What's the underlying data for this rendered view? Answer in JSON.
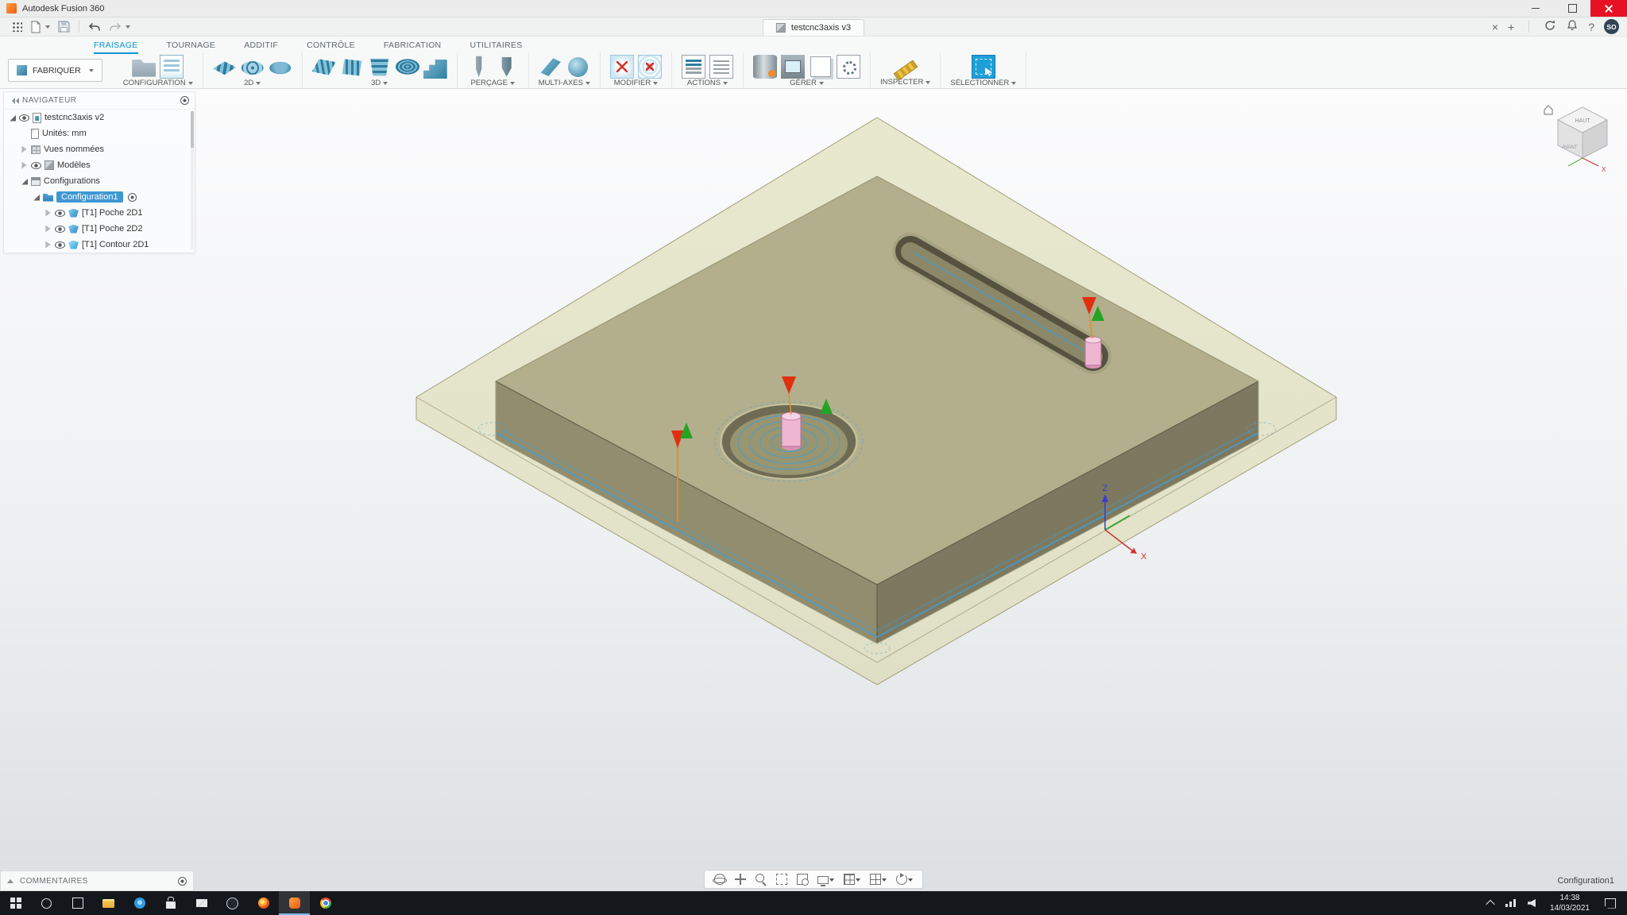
{
  "titlebar": {
    "title": "Autodesk Fusion 360"
  },
  "appbar": {
    "document_tab": "testcnc3axis v3",
    "close_tab_glyph": "×",
    "new_tab_glyph": "+",
    "help_glyph": "?",
    "avatar_initials": "SO"
  },
  "ribbon": {
    "tabs": [
      {
        "label": "FRAISAGE",
        "active": true
      },
      {
        "label": "TOURNAGE"
      },
      {
        "label": "ADDITIF"
      },
      {
        "label": "CONTRÔLE"
      },
      {
        "label": "FABRICATION"
      },
      {
        "label": "UTILITAIRES"
      }
    ],
    "make_button": {
      "label": "FABRIQUER"
    },
    "groups": [
      {
        "label": "CONFIGURATION",
        "icons": [
          "setup-folder",
          "setup-doc"
        ]
      },
      {
        "label": "2D",
        "icons": [
          "face-2d",
          "adaptive-2d",
          "pocket-2d"
        ]
      },
      {
        "label": "3D",
        "icons": [
          "adaptive-3d",
          "parallel-3d",
          "contour-3d",
          "spiral-3d",
          "ramp-3d"
        ]
      },
      {
        "label": "PERÇAGE",
        "icons": [
          "drill",
          "bore"
        ]
      },
      {
        "label": "MULTI-AXES",
        "icons": [
          "swarf",
          "multiaxis"
        ]
      },
      {
        "label": "MODIFIER",
        "icons": [
          "edit-toolpath",
          "delete-toolpath"
        ]
      },
      {
        "label": "ACTIONS",
        "icons": [
          "post-process",
          "simulate"
        ]
      },
      {
        "label": "GÉRER",
        "icons": [
          "tool-library",
          "machine-library",
          "templates",
          "post-library"
        ]
      },
      {
        "label": "INSPECTER",
        "icons": [
          "measure"
        ]
      },
      {
        "label": "SÉLECTIONNER",
        "icons": [
          "select-window"
        ]
      }
    ]
  },
  "navigator": {
    "title": "NAVIGATEUR",
    "items": [
      {
        "label": "testcnc3axis v2",
        "level": 0,
        "icons": [
          "expand-open",
          "eye",
          "doc-cube"
        ]
      },
      {
        "label": "Unités: mm",
        "level": 1,
        "icons": [
          "spacer",
          "doc"
        ]
      },
      {
        "label": "Vues nommées",
        "level": 1,
        "icons": [
          "expand-closed",
          "views"
        ]
      },
      {
        "label": "Modèles",
        "level": 1,
        "icons": [
          "expand-closed",
          "eye",
          "cube"
        ]
      },
      {
        "label": "Configurations",
        "level": 1,
        "icons": [
          "expand-open",
          "configs"
        ]
      },
      {
        "label": "Configuration1",
        "level": 2,
        "icons": [
          "expand-open",
          "folder-config"
        ],
        "selected": true,
        "trailing": [
          "gear-ring"
        ]
      },
      {
        "label": "[T1] Poche 2D1",
        "level": 3,
        "icons": [
          "expand-closed",
          "eye",
          "op-pocket"
        ]
      },
      {
        "label": "[T1] Poche 2D2",
        "level": 3,
        "icons": [
          "expand-closed",
          "eye",
          "op-pocket"
        ]
      },
      {
        "label": "[T1] Contour 2D1",
        "level": 3,
        "icons": [
          "expand-closed",
          "eye",
          "op-contour"
        ]
      }
    ]
  },
  "viewport": {
    "viewcube": {
      "top": "HAUT",
      "front": "AVANT"
    },
    "axis_labels": {
      "x": "X",
      "z": "Z"
    },
    "config_label": "Configuration1"
  },
  "comments": {
    "label": "COMMENTAIRES"
  },
  "navbar": [
    {
      "name": "orbit"
    },
    {
      "name": "pan"
    },
    {
      "name": "zoom"
    },
    {
      "name": "fit"
    },
    {
      "name": "zoom-window"
    },
    {
      "name": "display-settings",
      "caret": true
    },
    {
      "name": "grid-settings",
      "caret": true
    },
    {
      "name": "viewports",
      "caret": true
    },
    {
      "name": "camera-settings",
      "caret": true
    }
  ],
  "taskbar": {
    "items": [
      {
        "name": "start"
      },
      {
        "name": "search"
      },
      {
        "name": "task-view"
      },
      {
        "name": "file-explorer"
      },
      {
        "name": "edge"
      },
      {
        "name": "store"
      },
      {
        "name": "mail"
      },
      {
        "name": "media-app"
      },
      {
        "name": "firefox"
      },
      {
        "name": "fusion-360",
        "active": true
      },
      {
        "name": "chrome"
      }
    ],
    "tray": [
      {
        "name": "tray-expand"
      },
      {
        "name": "network"
      },
      {
        "name": "volume"
      }
    ],
    "time": "14:38",
    "date": "14/03/2021"
  },
  "colors": {
    "accent_blue": "#0a96d4",
    "selection_blue": "#3f97d3",
    "part_top": "#b3ae8c",
    "part_left": "#918d6e",
    "part_right": "#7d7960",
    "stock_fill": "rgba(214,214,160,0.5)",
    "pocket_wall": "#6e6b54",
    "pocket_floor": "#989571",
    "tool_pink": "#efb6d2",
    "toolpath_blue": "#3f9fd9",
    "arrow_red": "#e03010",
    "arrow_green": "#25a325",
    "stem_orange": "#e0902f"
  }
}
